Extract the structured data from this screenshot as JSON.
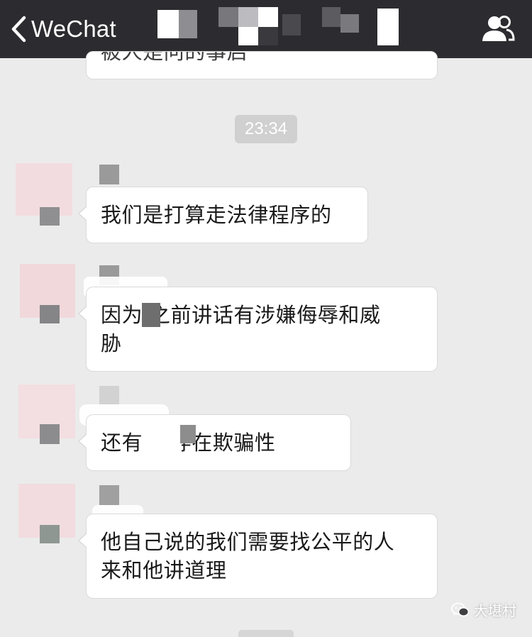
{
  "nav": {
    "back_label": "WeChat"
  },
  "chat": {
    "partial_message": "被人是问的事启",
    "timestamp": "23:34",
    "messages": [
      {
        "line1": "我们是打算走法律程序的",
        "line2": ""
      },
      {
        "line1": "因为  之前讲话有涉嫌侮辱和威",
        "line2": "胁"
      },
      {
        "line1": "还有    也存在欺骗性",
        "line2": ""
      },
      {
        "line1": "他自己说的我们需要找公平的人",
        "line2": "来和他讲道理"
      }
    ]
  },
  "watermark": {
    "text": "大堪村",
    "icon": "wechat-logo-icon"
  },
  "colors": {
    "nav_bg": "#2c2c30",
    "chat_bg": "#ebebeb",
    "bubble_bg": "#ffffff",
    "time_pill_bg": "#d0d0d0"
  }
}
